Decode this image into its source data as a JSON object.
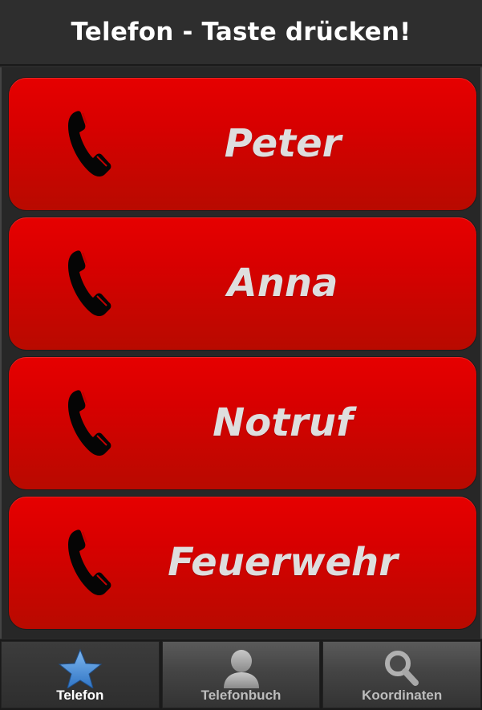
{
  "header": {
    "title": "Telefon - Taste drücken!"
  },
  "contacts": [
    {
      "label": "Peter",
      "icon": "phone-icon"
    },
    {
      "label": "Anna",
      "icon": "phone-icon"
    },
    {
      "label": "Notruf",
      "icon": "phone-icon"
    },
    {
      "label": "Feuerwehr",
      "icon": "phone-icon"
    }
  ],
  "tabs": [
    {
      "label": "Telefon",
      "icon": "star-icon",
      "active": true
    },
    {
      "label": "Telefonbuch",
      "icon": "person-icon",
      "active": false
    },
    {
      "label": "Koordinaten",
      "icon": "magnifier-icon",
      "active": false
    }
  ],
  "colors": {
    "button_red": "#d80000",
    "button_text": "#dedede",
    "tab_active_icon": "#4a90d9",
    "tab_inactive_icon": "#9a9a9a"
  }
}
